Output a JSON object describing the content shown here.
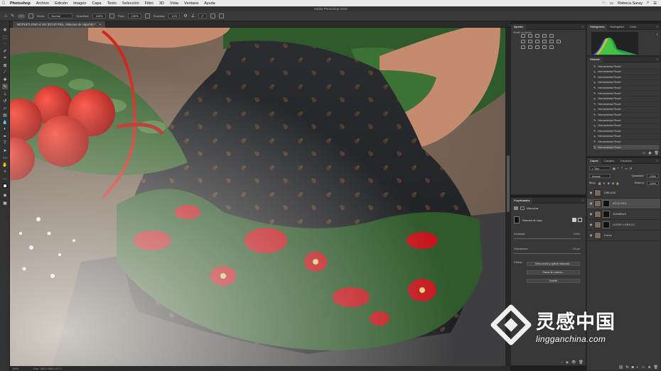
{
  "menubar": {
    "app_name": "Photoshop",
    "items": [
      "Archivo",
      "Edición",
      "Imagen",
      "Capa",
      "Texto",
      "Selección",
      "Filtro",
      "3D",
      "Vista",
      "Ventana",
      "Ayuda"
    ],
    "user": "Rebeca Saray"
  },
  "window_title": "Adobe Photoshop 2020",
  "options_bar": {
    "brush_size": "800",
    "mode_label": "Modo:",
    "mode_value": "Normal",
    "opacity_label": "Opacidad:",
    "opacity_value": "100%",
    "flow_label": "Flujo:",
    "flow_value": "100%",
    "smoothing_label": "Suavizar:",
    "smoothing_value": "10%",
    "angle_value": "0°"
  },
  "document_tab": "MOP1871.ENG al 100 (ROJO PIEL, Máscara de capa/16) *",
  "status_bar": {
    "zoom": "66%",
    "doc_size": "Doc: 200,5 MB/1,03 G"
  },
  "adjustments_panel": {
    "tab": "Ajustes",
    "hint": "Añadir un ajuste"
  },
  "properties_panel": {
    "tab": "Propiedades",
    "type": "Máscaras",
    "mask_label": "Máscara de capa",
    "density_label": "Densidad:",
    "density_value": "100%",
    "feather_label": "Desvanecer:",
    "feather_value": "0,0 px",
    "refine_label": "Refinar:",
    "btn_select_mask": "Seleccionar y aplicar máscara...",
    "btn_color_range": "Gama de colores...",
    "btn_invert": "Invertir"
  },
  "histogram_panel": {
    "tabs": [
      "Histograma",
      "Navegador",
      "Color"
    ],
    "warning": "!"
  },
  "history_panel": {
    "tab": "Historia",
    "items": [
      "Herramienta Pincel",
      "Herramienta Pincel",
      "Herramienta Pincel",
      "Herramienta Pincel",
      "Herramienta Pincel",
      "Herramienta Pincel",
      "Herramienta Pincel",
      "Herramienta Pincel",
      "Herramienta Pincel",
      "Herramienta Pincel",
      "Herramienta Pincel",
      "Herramienta Pincel",
      "Herramienta Pincel",
      "Herramienta Pincel",
      "Herramienta Pincel",
      "Herramienta Pincel"
    ]
  },
  "layers_panel": {
    "tabs": [
      "Capas",
      "Canales",
      "Trazados"
    ],
    "filter_label": "Tipo",
    "blend_mode": "Normal",
    "opacity_label": "Opacidad:",
    "opacity_value": "100%",
    "lock_label": "Bloq.:",
    "fill_label": "Relleno:",
    "fill_value": "100%",
    "layers": [
      {
        "name": "DIBUJOS",
        "has_mask": false,
        "selected": false
      },
      {
        "name": "ROJO PIEL",
        "has_mask": true,
        "selected": true
      },
      {
        "name": "SOMBRAS",
        "has_mask": true,
        "selected": false
      },
      {
        "name": "LUCES Y BRILLO",
        "has_mask": true,
        "selected": false
      },
      {
        "name": "Fondo",
        "has_mask": false,
        "selected": false
      }
    ]
  },
  "watermark": {
    "chinese": "灵感中国",
    "url": "lingganchina.com"
  }
}
